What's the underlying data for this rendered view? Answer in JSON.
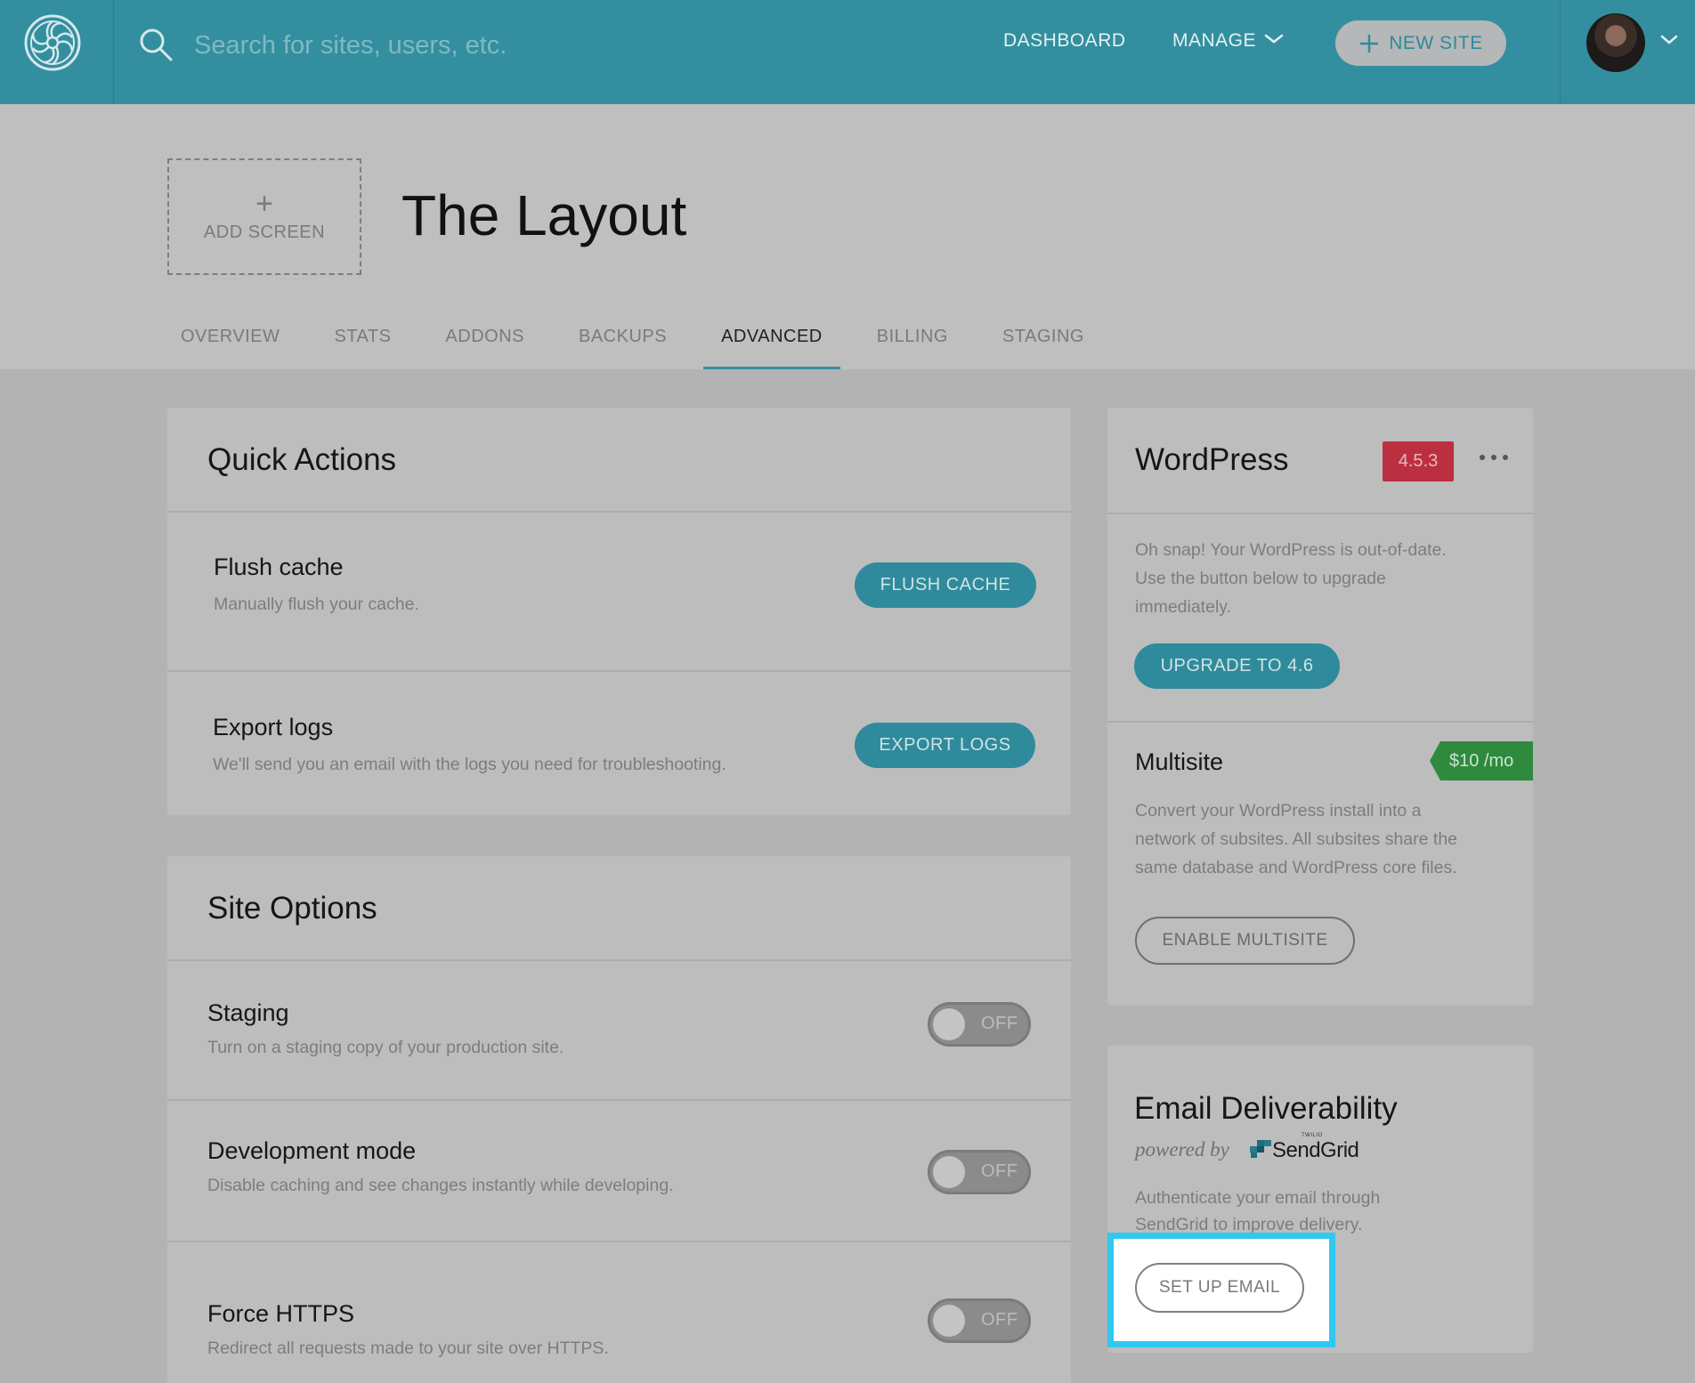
{
  "topbar": {
    "search_placeholder": "Search for sites, users, etc.",
    "nav_dashboard": "DASHBOARD",
    "nav_manage": "MANAGE",
    "new_site_label": "NEW SITE"
  },
  "site": {
    "add_screen_plus": "+",
    "add_screen_label": "ADD SCREEN",
    "title": "The Layout"
  },
  "tabs": [
    {
      "label": "OVERVIEW"
    },
    {
      "label": "STATS"
    },
    {
      "label": "ADDONS"
    },
    {
      "label": "BACKUPS"
    },
    {
      "label": "ADVANCED"
    },
    {
      "label": "BILLING"
    },
    {
      "label": "STAGING"
    }
  ],
  "quick_actions": {
    "title": "Quick Actions",
    "flush": {
      "title": "Flush cache",
      "desc": "Manually flush your cache.",
      "button": "FLUSH CACHE"
    },
    "export": {
      "title": "Export logs",
      "desc": "We'll send you an email with the logs you need for troubleshooting.",
      "button": "EXPORT LOGS"
    }
  },
  "site_options": {
    "title": "Site Options",
    "staging": {
      "title": "Staging",
      "desc": "Turn on a staging copy of your production site.",
      "toggle": "OFF"
    },
    "dev_mode": {
      "title": "Development mode",
      "desc": "Disable caching and see changes instantly while developing.",
      "toggle": "OFF"
    },
    "https": {
      "title": "Force HTTPS",
      "desc": "Redirect all requests made to your site over HTTPS.",
      "toggle": "OFF"
    }
  },
  "wordpress": {
    "title": "WordPress",
    "version": "4.5.3",
    "message_line1": "Oh snap! Your WordPress is out-of-date.",
    "message_line2": "Use the button below to upgrade",
    "message_line3": "immediately.",
    "upgrade_button": "UPGRADE TO 4.6",
    "multisite_title": "Multisite",
    "multisite_price": "$10 /mo",
    "multisite_line1": "Convert your WordPress install into a",
    "multisite_line2": "network of subsites. All subsites share the",
    "multisite_line3": "same database and WordPress core files.",
    "multisite_button": "ENABLE MULTISITE"
  },
  "email": {
    "title": "Email Deliverability",
    "powered_by": "powered by",
    "sendgrid_brand": "SendGrid",
    "twilio_brand": "TWILIO",
    "desc_line1": "Authenticate your email through",
    "desc_line2": "SendGrid to improve delivery.",
    "button": "SET UP EMAIL"
  },
  "colors": {
    "topbar": "#338f9f",
    "accent": "#2f8b9b",
    "version_badge": "#bc2f41",
    "price_badge": "#2e8b3d",
    "highlight": "#30c7f0"
  },
  "icons": [
    "logo-icon",
    "search-icon",
    "chevron-down-icon",
    "plus-icon",
    "avatar",
    "more-icon",
    "sendgrid-logo-icon"
  ]
}
